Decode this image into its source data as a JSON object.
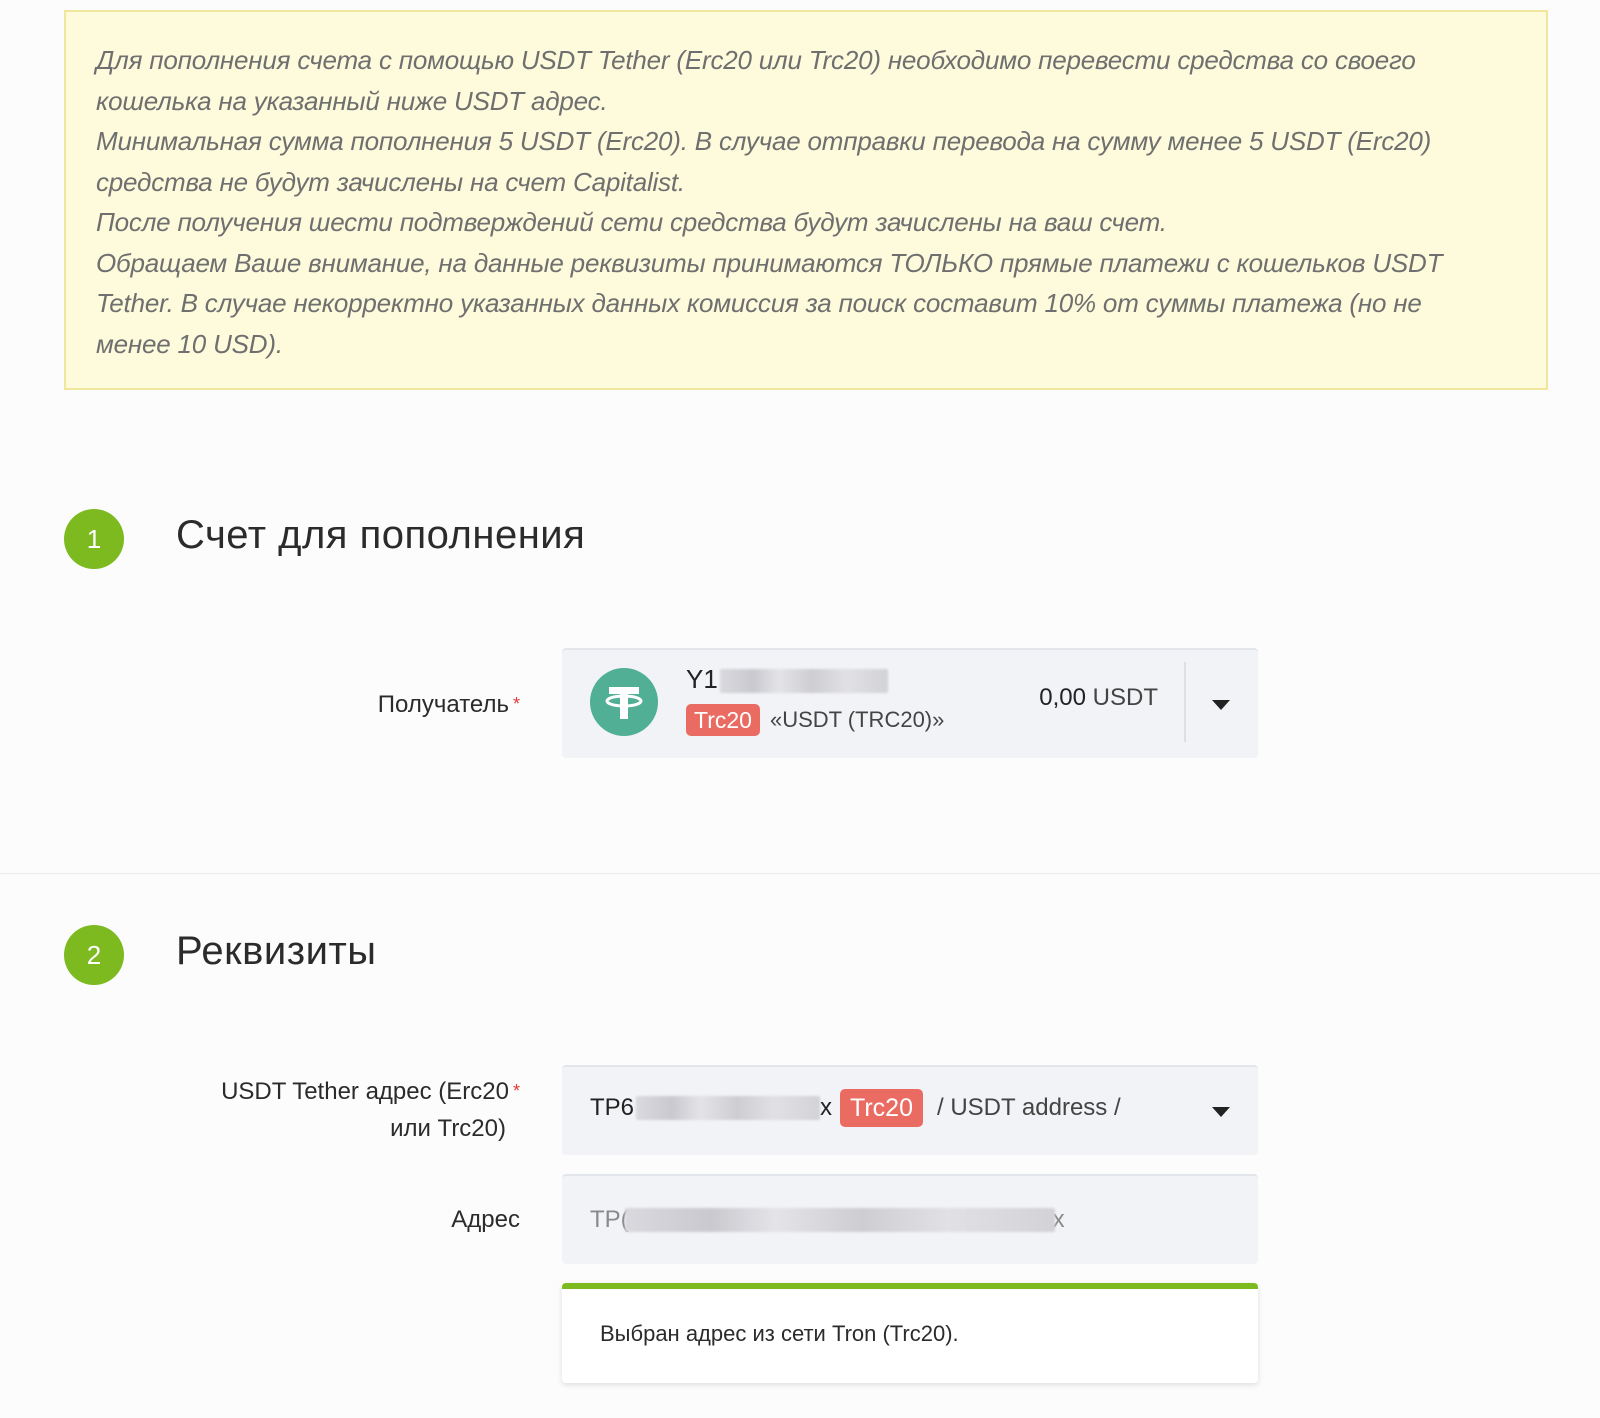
{
  "notice": {
    "lines": [
      "Для пополнения счета с помощью USDT Tether (Erc20 или Trc20) необходимо перевести средства со своего",
      "кошелька на указанный ниже USDT адрес.",
      "Минимальная сумма пополнения 5 USDT (Erc20). В случае отправки перевода на сумму менее 5 USDT (Erc20)",
      "средства не будут зачислены на счет Capitalist.",
      "После получения шести подтверждений сети средства будут зачислены на ваш счет.",
      "Обращаем Ваше внимание, на данные реквизиты принимаются ТОЛЬКО прямые платежи с кошельков USDT",
      "Tether. В случае некорректно указанных данных комиссия за поиск составит 10% от суммы платежа (но не",
      "менее 10 USD)."
    ]
  },
  "section1": {
    "number": "1",
    "title": "Счет для пополнения",
    "recipient_label": "Получатель",
    "required_mark": "*",
    "account": {
      "id_prefix": "Y1",
      "network_badge": "Trc20",
      "name": "«USDT (TRC20)»",
      "balance_value": "0,00",
      "balance_currency": "USDT",
      "icon": "tether-icon"
    }
  },
  "section2": {
    "number": "2",
    "title": "Реквизиты",
    "address_select_label_line1": "USDT Tether адрес (Erc20",
    "address_select_label_line2": "или Trc20)",
    "required_mark": "*",
    "address_select": {
      "prefix": "TP6",
      "suffix": "x",
      "network_badge": "Trc20",
      "subtitle": "/ USDT address /"
    },
    "address_label": "Адрес",
    "address_input": {
      "prefix": "TP(",
      "suffix": "x"
    },
    "info_message": "Выбран адрес из сети Tron (Trc20)."
  },
  "colors": {
    "accent_green": "#7cba20",
    "badge_red": "#ea6b62",
    "tether_green": "#50af95",
    "notice_bg": "#fdfbdc"
  }
}
